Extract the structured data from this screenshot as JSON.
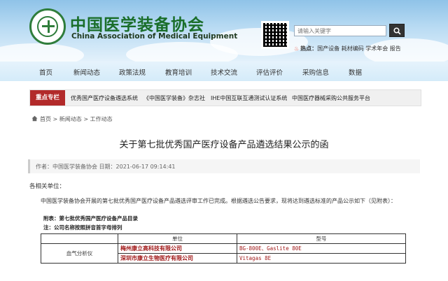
{
  "header": {
    "title_cn": "中国医学装备协会",
    "title_en": "China Association of Medical Equipment",
    "search_placeholder": "请输入关键字",
    "hot_label": "热点：",
    "hot_items": "国产设备  耗材编码  学术年会  报告"
  },
  "nav": {
    "items": [
      "首页",
      "新闻动态",
      "政策法规",
      "教育培训",
      "技术交流",
      "评估评价",
      "采购信息",
      "数据"
    ]
  },
  "focus": {
    "label": "重点专栏",
    "links": [
      "优秀国产医疗设备遴选系统",
      "《中国医学装备》杂志社",
      "IHE中国互联互通测试认证系统",
      "中国医疗器械采购公共服务平台"
    ]
  },
  "breadcrumb": [
    "首页",
    "新闻动态",
    "工作动态"
  ],
  "article": {
    "title": "关于第七批优秀国产医疗设备产品遴选结果公示的函",
    "meta": "作者：中国医学装备协会   日期：2021-06-17 09:14:41",
    "salutation": "各相关单位：",
    "body": "中国医学装备协会开展的第七批优秀国产医疗设备产品遴选评审工作已完成。根据遴选公告要求，现将达到遴选标准的产品公示如下（见附表）：",
    "attach_line1": "附表：第七批优秀国产医疗设备产品目录",
    "attach_line2": "注：公司名称按照拼音首字母排列"
  },
  "table": {
    "headers": [
      "",
      "单位",
      "型号"
    ],
    "category": "血气分析仪",
    "rows": [
      {
        "unit": "梅州康立高科技有限公司",
        "model": "BG-800E、Gaslite 80E"
      },
      {
        "unit": "深圳市康立生物医疗有限公司",
        "model": "Vitagas 8E"
      }
    ]
  },
  "colors": {
    "brand_green": "#1a6e2a",
    "focus_red": "#b22a2a",
    "table_red": "#a11a1a"
  }
}
